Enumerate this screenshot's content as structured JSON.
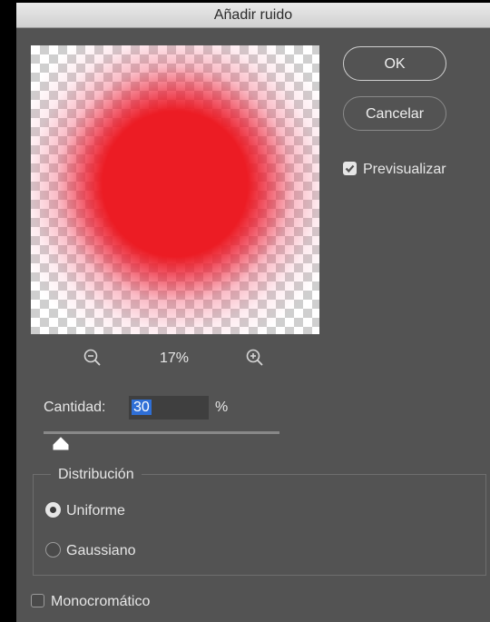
{
  "window": {
    "title": "Añadir ruido"
  },
  "buttons": {
    "ok": "OK",
    "cancel": "Cancelar"
  },
  "preview_toggle": {
    "label": "Previsualizar",
    "checked": true
  },
  "zoom": {
    "level": "17%",
    "zoom_out_icon": "zoom-out-magnifier",
    "zoom_in_icon": "zoom-in-magnifier"
  },
  "amount": {
    "label": "Cantidad:",
    "value": "30",
    "unit": "%",
    "slider_fraction": 0.075
  },
  "distribution": {
    "legend": "Distribución",
    "options": [
      {
        "label": "Uniforme",
        "selected": true
      },
      {
        "label": "Gaussiano",
        "selected": false
      }
    ]
  },
  "monochrome": {
    "label": "Monocromático",
    "checked": false
  },
  "colors": {
    "preview_red": "#ec1c24",
    "selection": "#2f6fd6",
    "panel": "#535353"
  }
}
